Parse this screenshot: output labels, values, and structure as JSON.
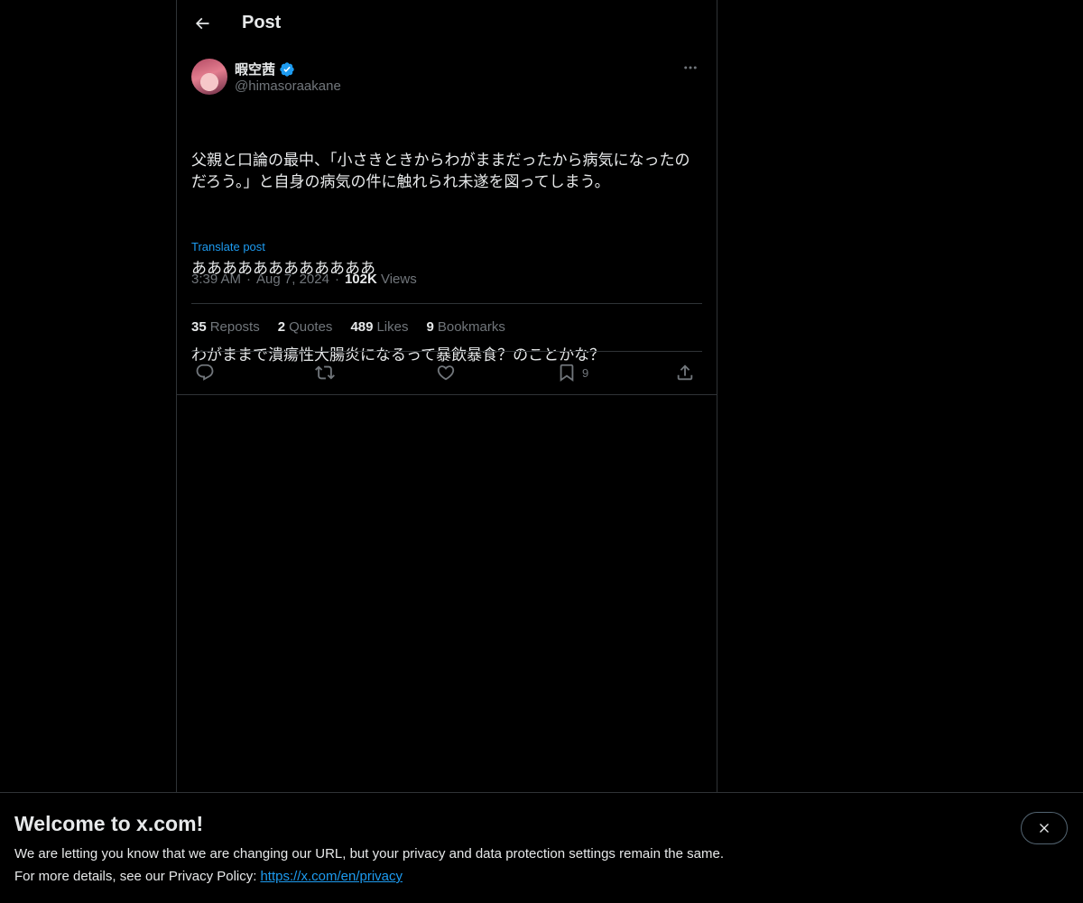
{
  "header": {
    "title": "Post",
    "back_icon": "arrow-left-icon"
  },
  "author": {
    "display_name": "暇空茜",
    "handle": "@himasoraakane",
    "verified_color": "#1d9bf0"
  },
  "post": {
    "paragraphs": [
      "父親と口論の最中、「小さきときからわがままだったから病気になったのだろう。」と自身の病気の件に触れられ未遂を図ってしまう。",
      "ああああああああああああ",
      "わがままで潰瘍性大腸炎になるって暴飲暴食？のことかな？"
    ],
    "translate_label": "Translate post",
    "time": "3:39 AM",
    "date": "Aug 7, 2024",
    "views_count": "102K",
    "views_label": "Views"
  },
  "stats": {
    "reposts_count": "35",
    "reposts_label": "Reposts",
    "quotes_count": "2",
    "quotes_label": "Quotes",
    "likes_count": "489",
    "likes_label": "Likes",
    "bookmarks_count": "9",
    "bookmarks_label": "Bookmarks"
  },
  "actions": {
    "reply_icon": "reply-icon",
    "repost_icon": "repost-icon",
    "like_icon": "heart-icon",
    "bookmark_icon": "bookmark-icon",
    "bookmark_count": "9",
    "share_icon": "share-icon"
  },
  "banner": {
    "title": "Welcome to x.com!",
    "line1": "We are letting you know that we are changing our URL, but your privacy and data protection settings remain the same.",
    "line2_prefix": "For more details, see our Privacy Policy:",
    "link_text": "https://x.com/en/privacy"
  },
  "colors": {
    "background": "#000000",
    "text": "#e7e9ea",
    "muted": "#71767b",
    "accent": "#1d9bf0",
    "border": "#2f3336"
  }
}
